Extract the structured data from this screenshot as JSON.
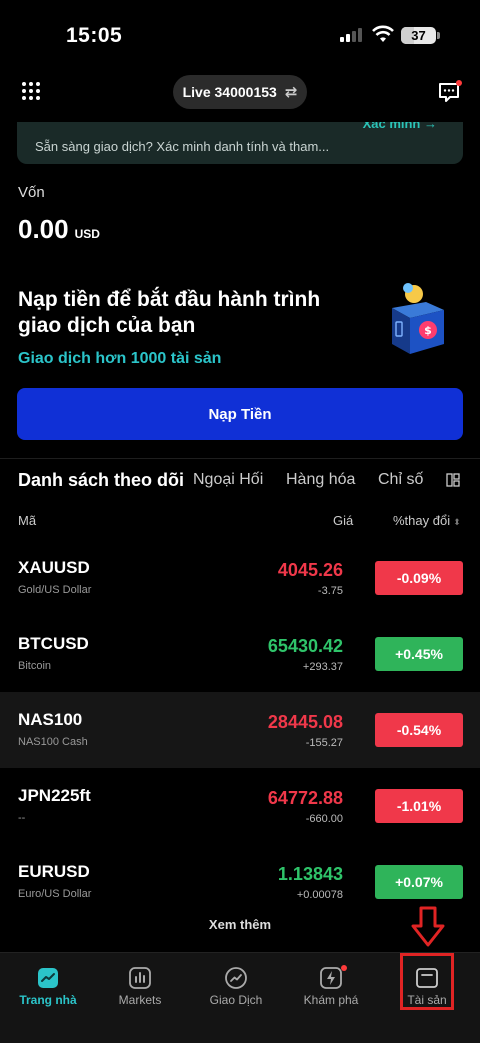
{
  "status_bar": {
    "time": "15:05",
    "battery": "37",
    "battery_level": 0.37
  },
  "top_bar": {
    "account_label": "Live 34000153"
  },
  "verify_banner": {
    "link": "Xác minh →",
    "text": "Sẵn sàng giao dịch? Xác minh danh tính và tham..."
  },
  "capital": {
    "label": "Vốn",
    "value": "0.00",
    "currency": "USD"
  },
  "deposit": {
    "title": "Nạp tiền để bắt đầu hành trình giao dịch của bạn",
    "subtitle": "Giao dịch hơn 1000 tài sản",
    "button": "Nạp Tiền"
  },
  "watchlist": {
    "tabs": [
      "Danh sách theo dõi",
      "Ngoại Hối",
      "Hàng hóa",
      "Chỉ số"
    ],
    "headers": {
      "symbol": "Mã",
      "price": "Giá",
      "change_pct": "%thay đổi"
    },
    "rows": [
      {
        "symbol": "XAUUSD",
        "desc": "Gold/US Dollar",
        "price": "4045.26",
        "change": "-3.75",
        "pct": "-0.09%",
        "dir": "down"
      },
      {
        "symbol": "BTCUSD",
        "desc": "Bitcoin",
        "price": "65430.42",
        "change": "+293.37",
        "pct": "+0.45%",
        "dir": "up"
      },
      {
        "symbol": "NAS100",
        "desc": "NAS100 Cash",
        "price": "28445.08",
        "change": "-155.27",
        "pct": "-0.54%",
        "dir": "down"
      },
      {
        "symbol": "JPN225ft",
        "desc": "--",
        "price": "64772.88",
        "change": "-660.00",
        "pct": "-1.01%",
        "dir": "down"
      },
      {
        "symbol": "EURUSD",
        "desc": "Euro/US Dollar",
        "price": "1.13843",
        "change": "+0.00078",
        "pct": "+0.07%",
        "dir": "up"
      }
    ],
    "see_more": "Xem thêm"
  },
  "bottom_nav": [
    {
      "label": "Trang nhà",
      "icon": "home-chart-icon",
      "active": true
    },
    {
      "label": "Markets",
      "icon": "bar-chart-icon",
      "active": false
    },
    {
      "label": "Giao Dịch",
      "icon": "trade-chart-icon",
      "active": false
    },
    {
      "label": "Khám phá",
      "icon": "explore-icon",
      "active": false
    },
    {
      "label": "Tài sản",
      "icon": "wallet-icon",
      "active": false
    }
  ],
  "colors": {
    "accent": "#2bc4c9",
    "primary_button": "#1030d6",
    "up": "#2fc46a",
    "down": "#f0384a",
    "annotation": "#e02424"
  }
}
